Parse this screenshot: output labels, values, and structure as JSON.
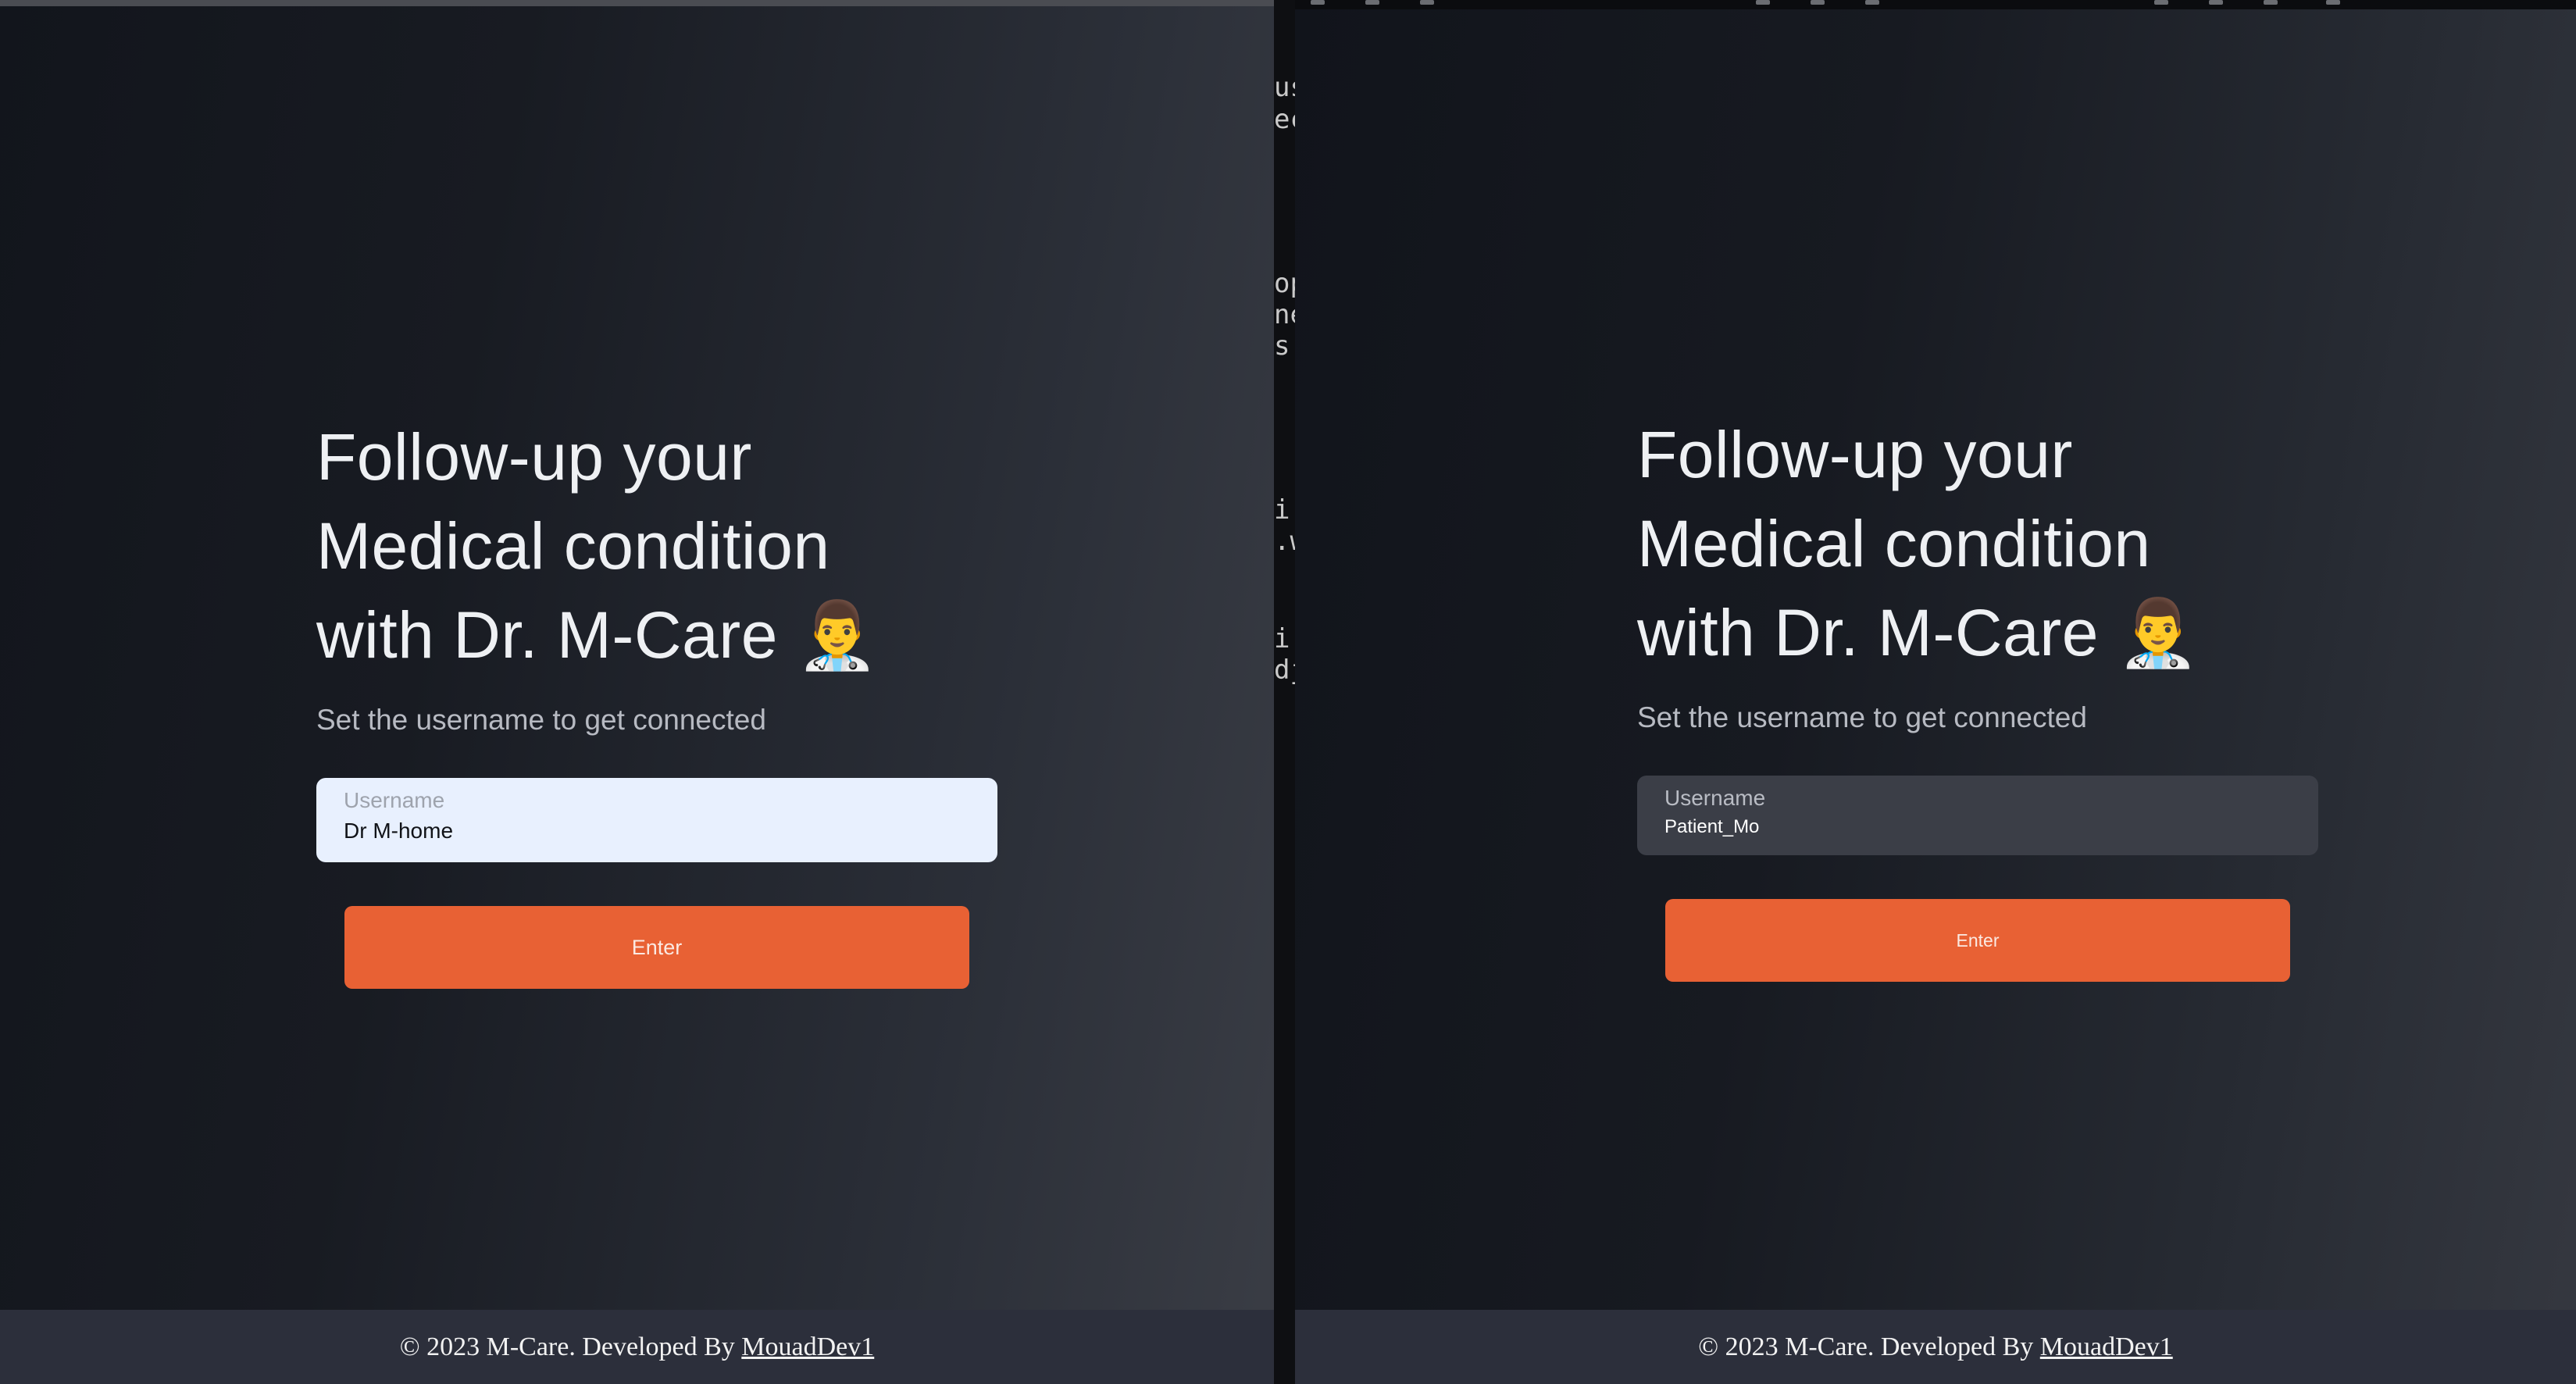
{
  "left_app": {
    "headline_line1": "Follow-up your",
    "headline_line2": "Medical condition",
    "headline_line3": "with Dr. M-Care 👨‍⚕️",
    "subtitle": "Set the username to get connected",
    "username_label": "Username",
    "username_value": "Dr M-home",
    "enter_label": "Enter",
    "footer_text": "© 2023 M-Care. Developed By",
    "footer_link": "MouadDev1"
  },
  "right_app": {
    "headline_line1": "Follow-up your",
    "headline_line2": "Medical condition",
    "headline_line3": "with Dr. M-Care 👨‍⚕️",
    "subtitle": "Set the username to get connected",
    "username_label": "Username",
    "username_value": "Patient_Mo",
    "enter_label": "Enter",
    "footer_text": "© 2023 M-Care. Developed By",
    "footer_link": "MouadDev1"
  },
  "background_editor_fragments": [
    "us",
    "ec",
    "op",
    "ne",
    "s",
    "i",
    ".w",
    "i",
    "dj"
  ],
  "colors": {
    "accent": "#e86134",
    "footer_bg": "#2c2f3b",
    "input_autofill_bg": "#e8f0fe",
    "input_bg": "#3b3e47"
  },
  "icons": {
    "doctor": "man-health-worker-emoji"
  }
}
